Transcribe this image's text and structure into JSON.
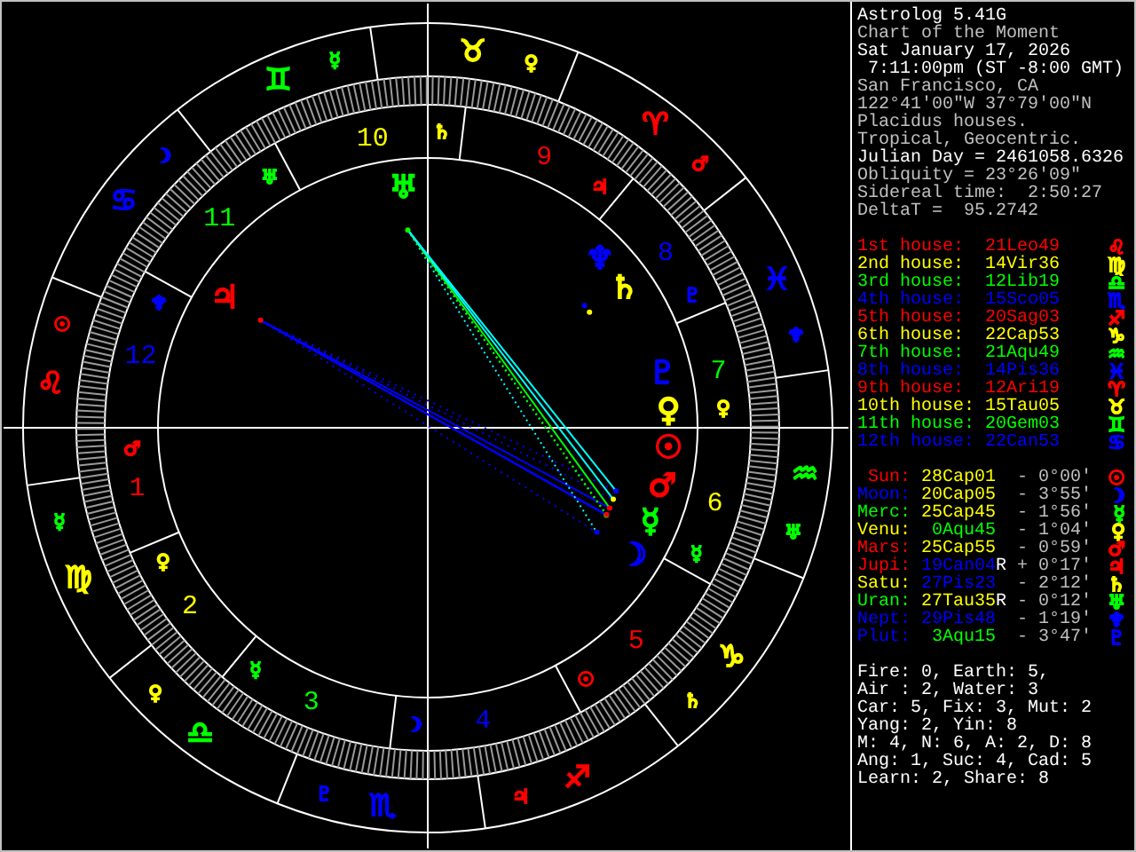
{
  "wheel": {
    "signs": [
      {
        "glyph": "♈",
        "color": "#ff0000",
        "ruler": {
          "glyph": "♂",
          "color": "#ff0000"
        }
      },
      {
        "glyph": "♉",
        "color": "#ffff00",
        "ruler": {
          "glyph": "♀",
          "color": "#ffff00"
        }
      },
      {
        "glyph": "♊",
        "color": "#00ff00",
        "ruler": {
          "glyph": "☿",
          "color": "#00ff00"
        }
      },
      {
        "glyph": "♋",
        "color": "#0000ff",
        "ruler": {
          "glyph": "☽",
          "color": "#0000ff"
        }
      },
      {
        "glyph": "♌",
        "color": "#ff0000",
        "ruler": {
          "glyph": "☉",
          "color": "#ff0000"
        }
      },
      {
        "glyph": "♍",
        "color": "#ffff00",
        "ruler": {
          "glyph": "☿",
          "color": "#00ff00"
        }
      },
      {
        "glyph": "♎",
        "color": "#00ff00",
        "ruler": {
          "glyph": "♀",
          "color": "#ffff00"
        }
      },
      {
        "glyph": "♏",
        "color": "#0000ff",
        "ruler": {
          "glyph": "♇",
          "color": "#0000ff"
        }
      },
      {
        "glyph": "♐",
        "color": "#ff0000",
        "ruler": {
          "glyph": "♃",
          "color": "#ff0000"
        }
      },
      {
        "glyph": "♑",
        "color": "#ffff00",
        "ruler": {
          "glyph": "♄",
          "color": "#ffff00"
        }
      },
      {
        "glyph": "♒",
        "color": "#00ff00",
        "ruler": {
          "glyph": "♅",
          "color": "#00ff00"
        }
      },
      {
        "glyph": "♓",
        "color": "#0000ff",
        "ruler": {
          "glyph": "♆",
          "color": "#0000ff"
        }
      }
    ],
    "houses": [
      {
        "number": "1",
        "color": "#ff0000",
        "ruler": {
          "glyph": "♂",
          "color": "#ff0000"
        }
      },
      {
        "number": "2",
        "color": "#ffff00",
        "ruler": {
          "glyph": "♀",
          "color": "#ffff00"
        }
      },
      {
        "number": "3",
        "color": "#00ff00",
        "ruler": {
          "glyph": "☿",
          "color": "#00ff00"
        }
      },
      {
        "number": "4",
        "color": "#0000ff",
        "ruler": {
          "glyph": "☽",
          "color": "#0000ff"
        }
      },
      {
        "number": "5",
        "color": "#ff0000",
        "ruler": {
          "glyph": "☉",
          "color": "#ff0000"
        }
      },
      {
        "number": "6",
        "color": "#ffff00",
        "ruler": {
          "glyph": "☿",
          "color": "#00ff00"
        }
      },
      {
        "number": "7",
        "color": "#00ff00",
        "ruler": {
          "glyph": "♀",
          "color": "#ffff00"
        }
      },
      {
        "number": "8",
        "color": "#0000ff",
        "ruler": {
          "glyph": "♇",
          "color": "#0000ff"
        }
      },
      {
        "number": "9",
        "color": "#ff0000",
        "ruler": {
          "glyph": "♃",
          "color": "#ff0000"
        }
      },
      {
        "number": "10",
        "color": "#ffff00",
        "ruler": {
          "glyph": "♄",
          "color": "#ffff00"
        }
      },
      {
        "number": "11",
        "color": "#00ff00",
        "ruler": {
          "glyph": "♅",
          "color": "#00ff00"
        }
      },
      {
        "number": "12",
        "color": "#0000ff",
        "ruler": {
          "glyph": "♆",
          "color": "#0000ff"
        }
      }
    ],
    "planets": [
      {
        "glyph": "☉",
        "color": "#ff0000"
      },
      {
        "glyph": "☽",
        "color": "#0000ff"
      },
      {
        "glyph": "☿",
        "color": "#00ff00"
      },
      {
        "glyph": "♀",
        "color": "#ffff00"
      },
      {
        "glyph": "♂",
        "color": "#ff0000"
      },
      {
        "glyph": "♃",
        "color": "#ff0000"
      },
      {
        "glyph": "♄",
        "color": "#ffff00"
      },
      {
        "glyph": "♅",
        "color": "#00ff00"
      },
      {
        "glyph": "♆",
        "color": "#0000ff"
      },
      {
        "glyph": "♇",
        "color": "#0000ff"
      }
    ]
  },
  "info": [
    {
      "text": "Astrolog 5.41G",
      "color": "#ffffff"
    },
    {
      "text": "Chart of the Moment",
      "color": "#c0c0c0"
    },
    {
      "text": "Sat January 17, 2026",
      "color": "#ffffff"
    },
    {
      "text": "7:11:00pm (ST -8:00 GMT)",
      "color": "#ffffff"
    },
    {
      "text": "San Francisco, CA",
      "color": "#c0c0c0"
    },
    {
      "text": "122°41'00\"W 37°79'00\"N",
      "color": "#c0c0c0"
    },
    {
      "text": "Placidus houses.",
      "color": "#c0c0c0"
    },
    {
      "text": "Tropical, Geocentric.",
      "color": "#c0c0c0"
    },
    {
      "text": "Julian Day = 2461058.6326",
      "color": "#ffffff"
    },
    {
      "text": "Obliquity = 23°26'09\"",
      "color": "#c0c0c0"
    },
    {
      "text": "Sidereal time:  2:50:27",
      "color": "#c0c0c0"
    },
    {
      "text": "DeltaT =  95.2742",
      "color": "#c0c0c0"
    }
  ],
  "house_table": [
    {
      "label": "1st house:",
      "value": "21Leo49",
      "glyph": "♌",
      "color": "#ff0000"
    },
    {
      "label": "2nd house:",
      "value": "14Vir36",
      "glyph": "♍",
      "color": "#ffff00"
    },
    {
      "label": "3rd house:",
      "value": "12Lib19",
      "glyph": "♎",
      "color": "#00ff00"
    },
    {
      "label": "4th house:",
      "value": "15Sco05",
      "glyph": "♏",
      "color": "#0000ff"
    },
    {
      "label": "5th house:",
      "value": "20Sag03",
      "glyph": "♐",
      "color": "#ff0000"
    },
    {
      "label": "6th house:",
      "value": "22Cap53",
      "glyph": "♑",
      "color": "#ffff00"
    },
    {
      "label": "7th house:",
      "value": "21Aqu49",
      "glyph": "♒",
      "color": "#00ff00"
    },
    {
      "label": "8th house:",
      "value": "14Pis36",
      "glyph": "♓",
      "color": "#0000ff"
    },
    {
      "label": "9th house:",
      "value": "12Ari19",
      "glyph": "♈",
      "color": "#ff0000"
    },
    {
      "label": "10th house:",
      "value": "15Tau05",
      "glyph": "♉",
      "color": "#ffff00"
    },
    {
      "label": "11th house:",
      "value": "20Gem03",
      "glyph": "♊",
      "color": "#00ff00"
    },
    {
      "label": "12th house:",
      "value": "22Can53",
      "glyph": "♋",
      "color": "#0000ff"
    }
  ],
  "planet_table": [
    {
      "name": {
        "text": "Sun:",
        "color": "#ff0000"
      },
      "position": {
        "text": "28Cap01",
        "color": "#ffff00"
      },
      "offset": "- 0°00'",
      "glyph": "☉",
      "color": "#ff0000"
    },
    {
      "name": {
        "text": "Moon:",
        "color": "#0000ff"
      },
      "position": {
        "text": "20Cap05",
        "color": "#ffff00"
      },
      "offset": "- 3°55'",
      "glyph": "☽",
      "color": "#0000ff"
    },
    {
      "name": {
        "text": "Merc:",
        "color": "#00ff00"
      },
      "position": {
        "text": "25Cap45",
        "color": "#ffff00"
      },
      "offset": "- 1°56'",
      "glyph": "☿",
      "color": "#00ff00"
    },
    {
      "name": {
        "text": "Venu:",
        "color": "#ffff00"
      },
      "position": {
        "text": "0Aqu45",
        "color": "#00ff00"
      },
      "offset": "- 1°04'",
      "glyph": "♀",
      "color": "#ffff00"
    },
    {
      "name": {
        "text": "Mars:",
        "color": "#ff0000"
      },
      "position": {
        "text": "25Cap55",
        "color": "#ffff00"
      },
      "offset": "- 0°59'",
      "glyph": "♂",
      "color": "#ff0000"
    },
    {
      "name": {
        "text": "Jupi:",
        "color": "#ff0000"
      },
      "position": {
        "text": "19Can04",
        "color": "#0000ff"
      },
      "flag": "R",
      "offset": "+ 0°17'",
      "glyph": "♃",
      "color": "#ff0000"
    },
    {
      "name": {
        "text": "Satu:",
        "color": "#ffff00"
      },
      "position": {
        "text": "27Pis23",
        "color": "#0000ff"
      },
      "offset": "- 2°12'",
      "glyph": "♄",
      "color": "#ffff00"
    },
    {
      "name": {
        "text": "Uran:",
        "color": "#00ff00"
      },
      "position": {
        "text": "27Tau35",
        "color": "#ffff00"
      },
      "flag": "R",
      "offset": "- 0°12'",
      "glyph": "♅",
      "color": "#00ff00"
    },
    {
      "name": {
        "text": "Nept:",
        "color": "#0000ff"
      },
      "position": {
        "text": "29Pis48",
        "color": "#0000ff"
      },
      "offset": "- 1°19'",
      "glyph": "♆",
      "color": "#0000ff"
    },
    {
      "name": {
        "text": "Plut:",
        "color": "#0000ff"
      },
      "position": {
        "text": "3Aqu15",
        "color": "#00ff00"
      },
      "offset": "- 3°47'",
      "glyph": "♇",
      "color": "#0000ff"
    }
  ],
  "stats": [
    "Fire: 0, Earth: 5,",
    "Air : 2, Water: 3",
    "Car: 5, Fix: 3, Mut: 2",
    "Yang: 2, Yin: 8",
    "M: 4, N: 6, A: 2, D: 8",
    "Ang: 1, Suc: 4, Cad: 5",
    "Learn: 2, Share: 8"
  ]
}
